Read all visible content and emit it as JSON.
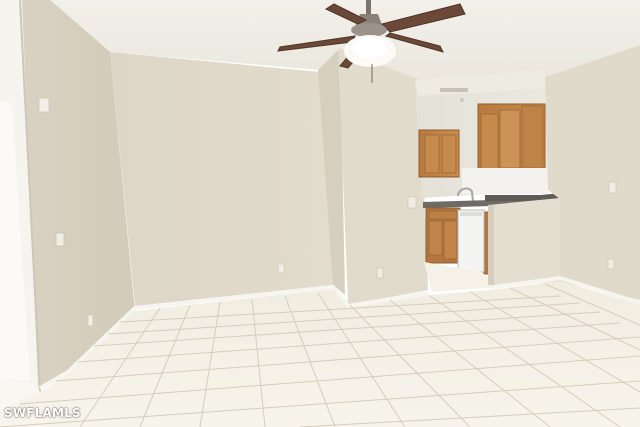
{
  "watermark": "SWFLAMLS"
}
